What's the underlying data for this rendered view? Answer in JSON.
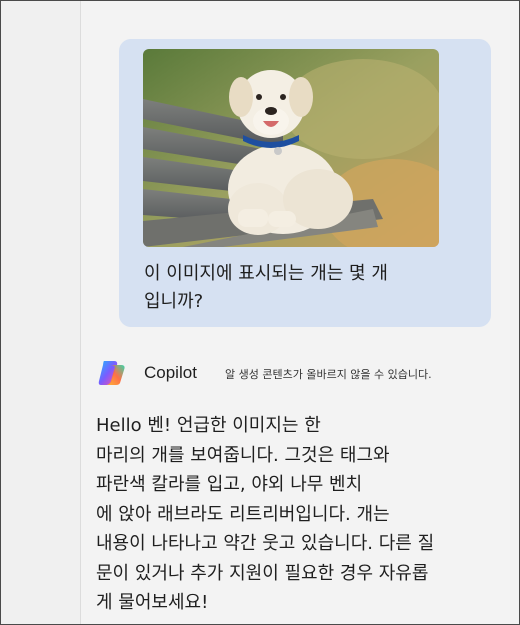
{
  "user_message": {
    "image_icon": "dog-photo",
    "line_1": "이 이미지에 표시되는 개는 몇 개",
    "line_2": "입니까?"
  },
  "assistant": {
    "logo_icon": "copilot-logo-icon",
    "name": "Copilot",
    "disclaimer": "알 생성 콘텐츠가 올바르지 않을 수 있습니다.",
    "reply_lines": [
      "Hello 벤! 언급한 이미지는 한",
      "마리의 개를 보여줍니다. 그것은 태그와",
      "파란색 칼라를 입고, 야외 나무 벤치",
      "에 앉아 래브라도 리트리버입니다. 개는",
      "내용이 나타나고 약간 웃고 있습니다. 다른 질",
      "문이 있거나 추가 지원이 필요한 경우 자유롭",
      "게 물어보세요!"
    ]
  },
  "colors": {
    "user_bubble": "#d6e1f2",
    "background": "#f3f3f3",
    "dog_collar": "#1e4fa0"
  }
}
